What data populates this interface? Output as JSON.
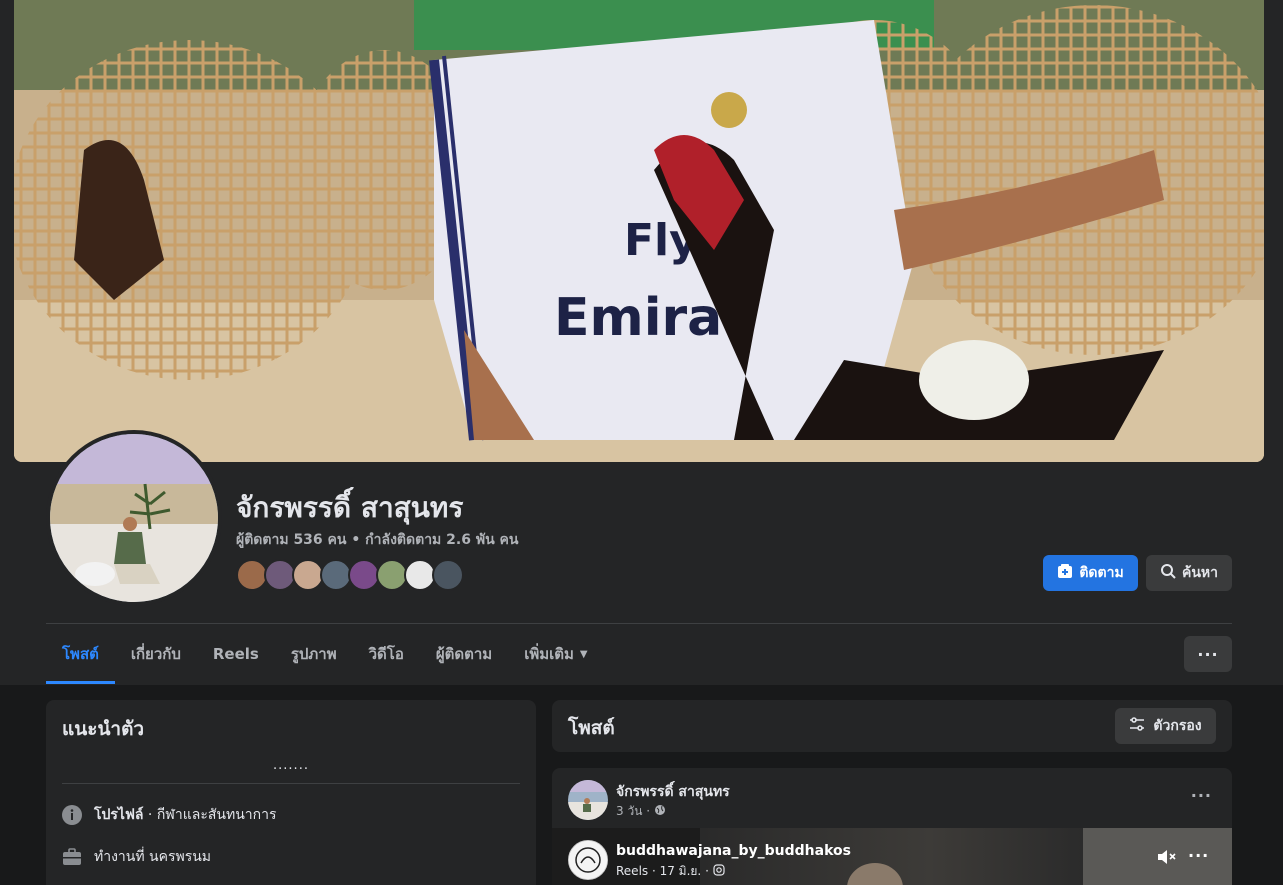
{
  "profile": {
    "name": "จักรพรรดิ์ สาสุนทร",
    "followers_text": "ผู้ติดตาม 536 คน • กำลังติดตาม 2.6 พัน คน"
  },
  "actions": {
    "follow_label": "ติดตาม",
    "search_label": "ค้นหา"
  },
  "tabs": [
    {
      "label": "โพสต์",
      "active": true
    },
    {
      "label": "เกี่ยวกับ"
    },
    {
      "label": "Reels"
    },
    {
      "label": "รูปภาพ"
    },
    {
      "label": "วิดีโอ"
    },
    {
      "label": "ผู้ติดตาม"
    },
    {
      "label": "เพิ่มเติม"
    }
  ],
  "more_button": "···",
  "intro": {
    "title": "แนะนำตัว",
    "bio": ".......",
    "rows": [
      {
        "icon": "info-icon",
        "prefix": "โปรไฟล์",
        "text": " · กีฬาและสันทนาการ"
      },
      {
        "icon": "briefcase-icon",
        "prefix": "",
        "text": "ทำงานที่ นครพรนม"
      }
    ]
  },
  "posts": {
    "title": "โพสต์",
    "filter_label": "ตัวกรอง",
    "items": [
      {
        "author": "จักรพรรดิ์ สาสุนทร",
        "time": "3 วัน ·",
        "reel": {
          "username": "buddhawajana_by_buddhakos",
          "meta": "Reels · 17 มิ.ย. ·"
        }
      }
    ]
  },
  "colors": {
    "accent": "#2374e1",
    "tab_active": "#2d88ff",
    "background": "#18191a",
    "surface": "#242526"
  }
}
